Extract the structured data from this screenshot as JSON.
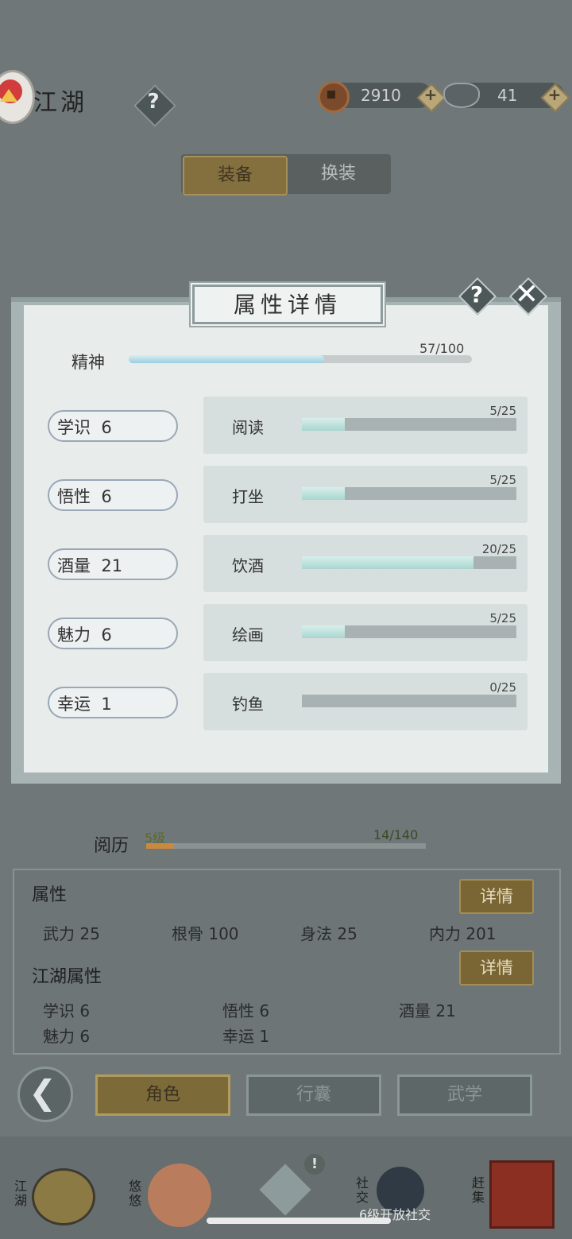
{
  "header": {
    "title": "江湖",
    "help": "?",
    "coins": "2910",
    "ingots": "41",
    "plus": "+"
  },
  "top_tabs": {
    "equip": "装备",
    "swap": "换装"
  },
  "modal": {
    "title": "属性详情",
    "help": "?",
    "close": "✕",
    "spirit": {
      "label": "精神",
      "value_text": "57/100",
      "fraction": 0.57
    },
    "attributes": [
      {
        "label": "学识",
        "value": "6"
      },
      {
        "label": "悟性",
        "value": "6"
      },
      {
        "label": "酒量",
        "value": "21"
      },
      {
        "label": "魅力",
        "value": "6"
      },
      {
        "label": "幸运",
        "value": "1"
      }
    ],
    "skills": [
      {
        "name": "阅读",
        "value_text": "5/25",
        "fraction": 0.2
      },
      {
        "name": "打坐",
        "value_text": "5/25",
        "fraction": 0.2
      },
      {
        "name": "饮酒",
        "value_text": "20/25",
        "fraction": 0.8
      },
      {
        "name": "绘画",
        "value_text": "5/25",
        "fraction": 0.2
      },
      {
        "name": "钓鱼",
        "value_text": "0/25",
        "fraction": 0.0
      }
    ]
  },
  "experience": {
    "label": "阅历",
    "level": "5级",
    "value_text": "14/140",
    "fraction": 0.1
  },
  "panel": {
    "attr_heading": "属性",
    "detail_btn": "详情",
    "attrs": [
      {
        "text": "武力  25"
      },
      {
        "text": "根骨  100"
      },
      {
        "text": "身法  25"
      },
      {
        "text": "内力  201"
      }
    ],
    "jianghu_heading": "江湖属性",
    "jianghu_attrs": [
      {
        "text": "学识  6"
      },
      {
        "text": "悟性  6"
      },
      {
        "text": "酒量  21"
      },
      {
        "text": "魅力  6"
      },
      {
        "text": "幸运  1"
      }
    ]
  },
  "bottom_tabs": {
    "role": "角色",
    "bag": "行囊",
    "martial": "武学"
  },
  "nav": {
    "jianghu": "江湖",
    "youyou": "悠悠",
    "social": "社交",
    "social_hint": "6级开放社交",
    "market": "赶集",
    "alert": "!"
  }
}
